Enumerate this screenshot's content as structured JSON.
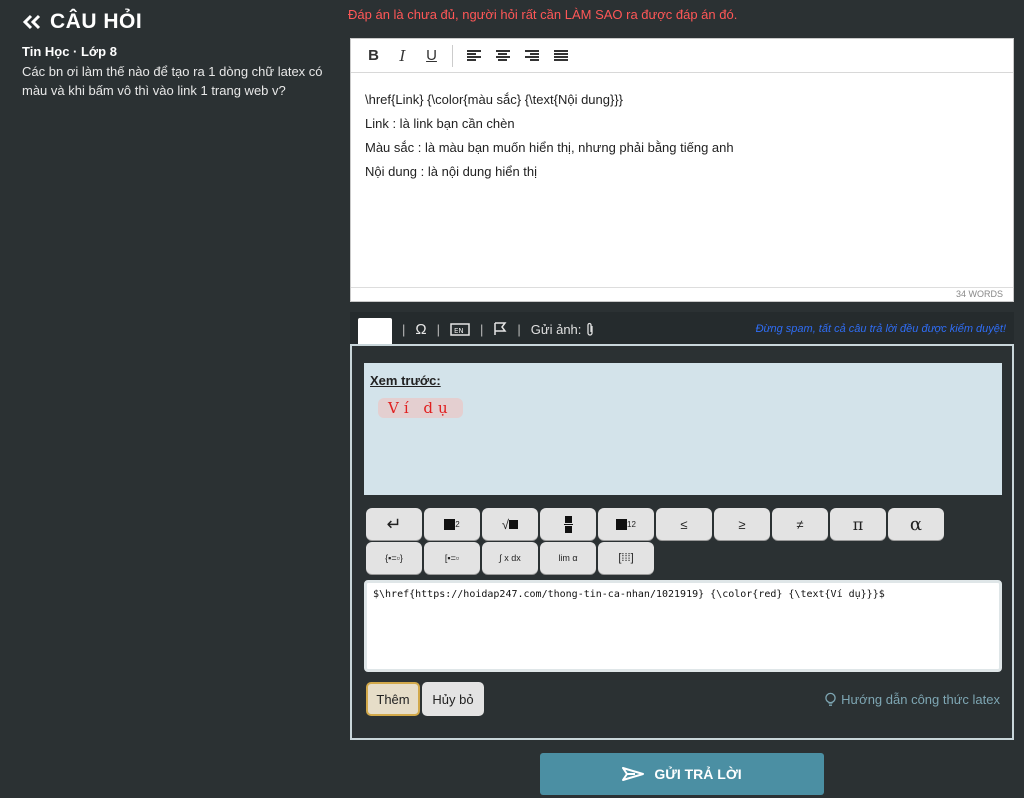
{
  "question": {
    "heading": "CÂU HỎI",
    "subject": "Tin Học · Lớp 8",
    "text": "Các bn ơi làm thế nào để tạo ra 1 dòng chữ latex có màu và khi bấm vô thì vào link 1 trang web v?"
  },
  "warning": "Đáp án là chưa đủ, người hỏi rất cần LÀM SAO ra được đáp án đó.",
  "editor": {
    "toolbar": {
      "bold": "B",
      "italic": "I",
      "underline": "U"
    },
    "lines": [
      "\\href{Link} {\\color{màu sắc} {\\text{Nội dung}}}",
      "Link : là link bạn cần chèn",
      "Màu sắc : là màu bạn muốn hiển thị, nhưng phải bằng tiếng anh",
      "Nội dung : là nội dung hiển thị"
    ],
    "word_count": "34 WORDS"
  },
  "tools": {
    "send_image": "Gửi ảnh:",
    "note": "Đừng spam, tất cả câu trả lời đều được kiểm duyệt!"
  },
  "formula": {
    "preview_label": "Xem trước:",
    "preview_text": "Ví dụ",
    "keys_row1": [
      "↵",
      "x²",
      "√x",
      "a/b",
      "x₁₂",
      "≤",
      "≥",
      "≠",
      "π",
      "α"
    ],
    "keys_row2": [
      "system",
      "bracket",
      "∫ x dx",
      "lim α",
      "[:::]"
    ],
    "latex_input": "$\\href{https://hoidap247.com/thong-tin-ca-nhan/1021919} {\\color{red} {\\text{Ví dụ}}}$",
    "add_label": "Thêm",
    "cancel_label": "Hủy bỏ",
    "guide_label": "Hướng dẫn công thức latex"
  },
  "submit_label": "GỬI TRẢ LỜI",
  "colors": {
    "background": "#2b3133",
    "warning": "#ff5757",
    "preview_bg": "#d3e3ea",
    "submit": "#4b8fa3",
    "note": "#2f6df5"
  }
}
